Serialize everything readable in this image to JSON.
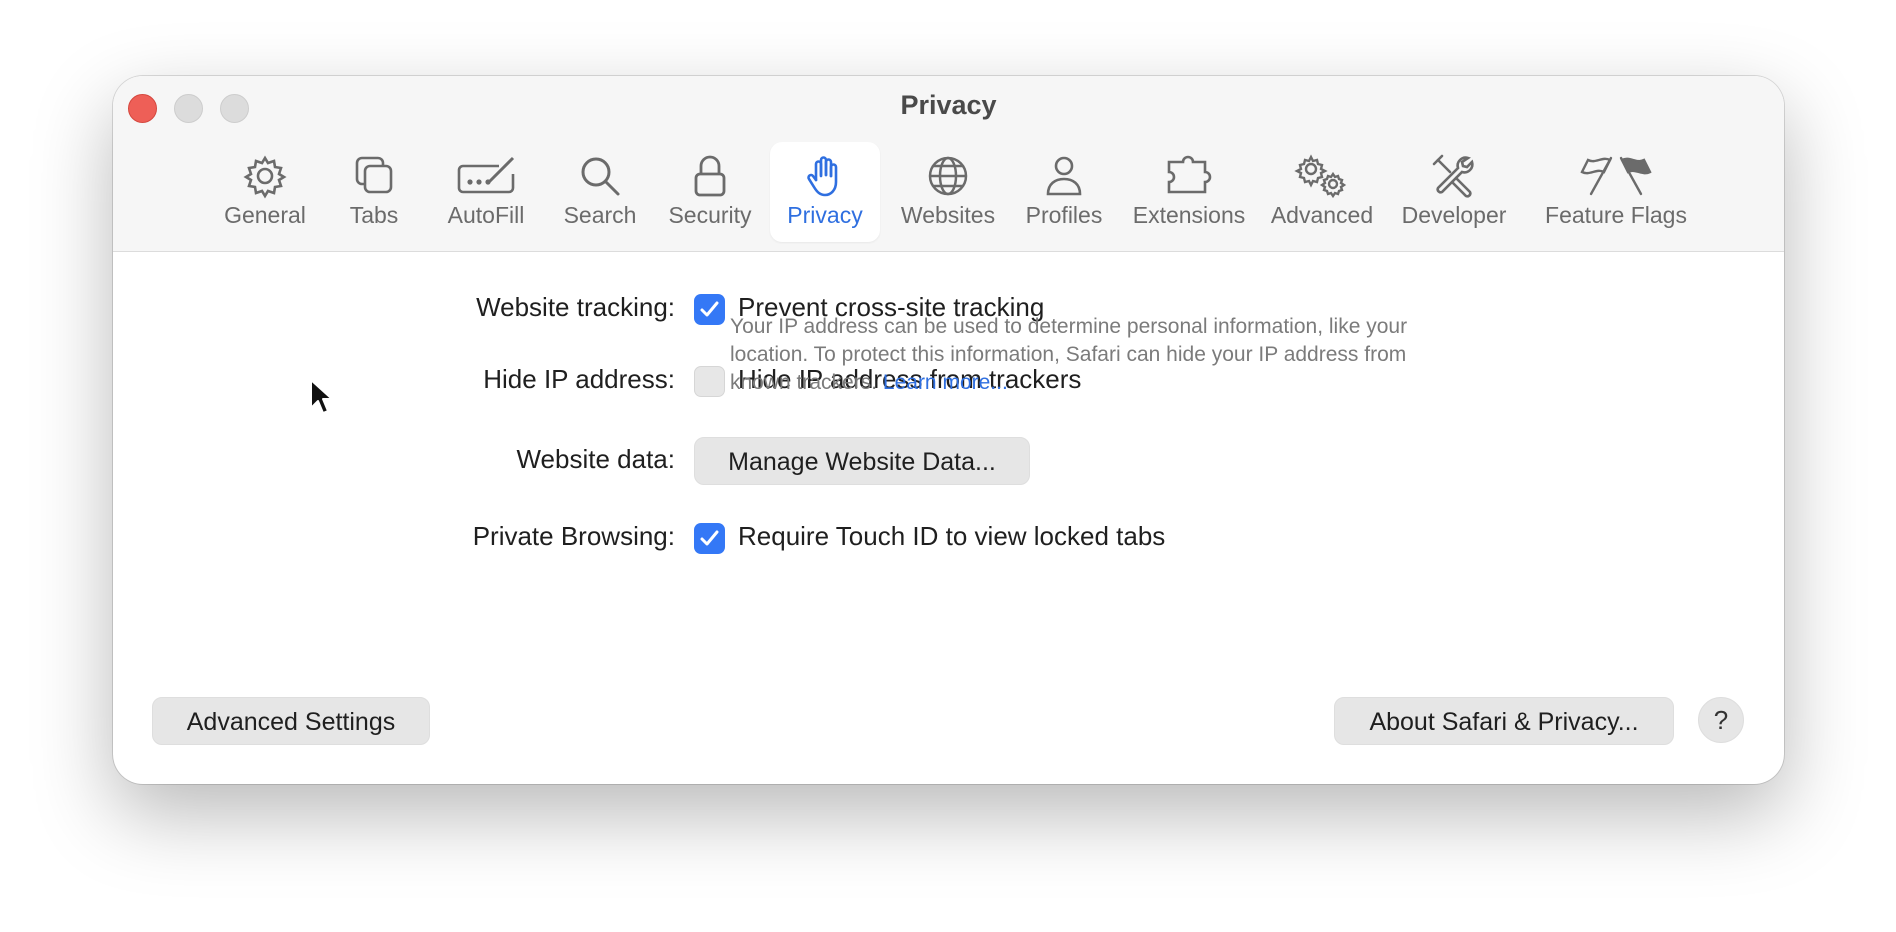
{
  "window": {
    "title": "Privacy"
  },
  "toolbar": {
    "tabs": [
      {
        "label": "General",
        "icon": "gear-icon"
      },
      {
        "label": "Tabs",
        "icon": "tabs-icon"
      },
      {
        "label": "AutoFill",
        "icon": "autofill-pen-icon"
      },
      {
        "label": "Search",
        "icon": "magnifier-icon"
      },
      {
        "label": "Security",
        "icon": "lock-icon"
      },
      {
        "label": "Privacy",
        "icon": "hand-icon",
        "active": true
      },
      {
        "label": "Websites",
        "icon": "globe-icon"
      },
      {
        "label": "Profiles",
        "icon": "person-icon"
      },
      {
        "label": "Extensions",
        "icon": "puzzle-icon"
      },
      {
        "label": "Advanced",
        "icon": "gears-icon"
      },
      {
        "label": "Developer",
        "icon": "tools-icon"
      },
      {
        "label": "Feature Flags",
        "icon": "flags-icon"
      }
    ]
  },
  "settings": {
    "website_tracking": {
      "label": "Website tracking:",
      "option": "Prevent cross-site tracking",
      "checked": true
    },
    "hide_ip": {
      "label": "Hide IP address:",
      "option": "Hide IP address from trackers",
      "checked": false,
      "description": "Your IP address can be used to determine personal information, like your location. To protect this information, Safari can hide your IP address from known trackers.",
      "link": "Learn more..."
    },
    "website_data": {
      "label": "Website data:",
      "button": "Manage Website Data..."
    },
    "private_browsing": {
      "label": "Private Browsing:",
      "option": "Require Touch ID to view locked tabs",
      "checked": true
    }
  },
  "footer": {
    "advanced_settings": "Advanced Settings",
    "about": "About Safari & Privacy...",
    "help": "?"
  },
  "colors": {
    "accent": "#3478f6",
    "link": "#2f6fe0",
    "close": "#ee5f57"
  }
}
